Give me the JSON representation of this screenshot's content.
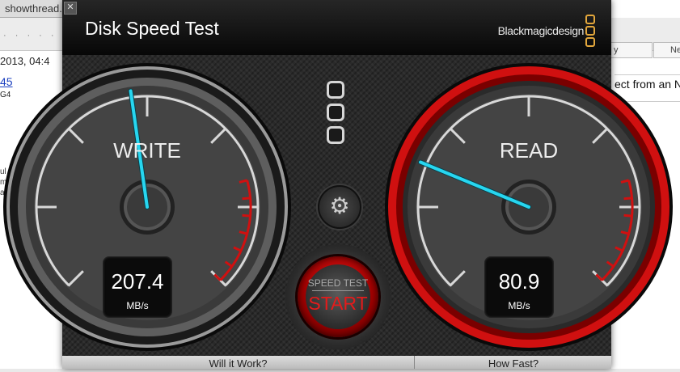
{
  "background": {
    "tab_title": "showthread.p",
    "tab_right_1": "y",
    "tab_right_2": "Ne",
    "date_text": "2013, 04:4",
    "post_number": "45",
    "post_label": "G4",
    "right_text": "ect from an N",
    "side_lines": [
      "ul",
      "m",
      "a"
    ]
  },
  "app": {
    "title": "Disk Speed Test",
    "brand": "Blackmagicdesign",
    "close_glyph": "✕",
    "accent_color": "#d01010",
    "needle_color": "#27d6f0"
  },
  "write_gauge": {
    "label": "WRITE",
    "value": "207.4",
    "unit": "MB/s",
    "needle_fraction": 0.47,
    "redline": false
  },
  "read_gauge": {
    "label": "READ",
    "value": "80.9",
    "unit": "MB/s",
    "needle_fraction": 0.25,
    "redline": true
  },
  "controls": {
    "settings_icon": "gear-icon",
    "settings_glyph": "⚙",
    "start_top_label": "SPEED TEST",
    "start_label": "START"
  },
  "bottom": {
    "left_label": "Will it Work?",
    "right_label": "How Fast?"
  }
}
